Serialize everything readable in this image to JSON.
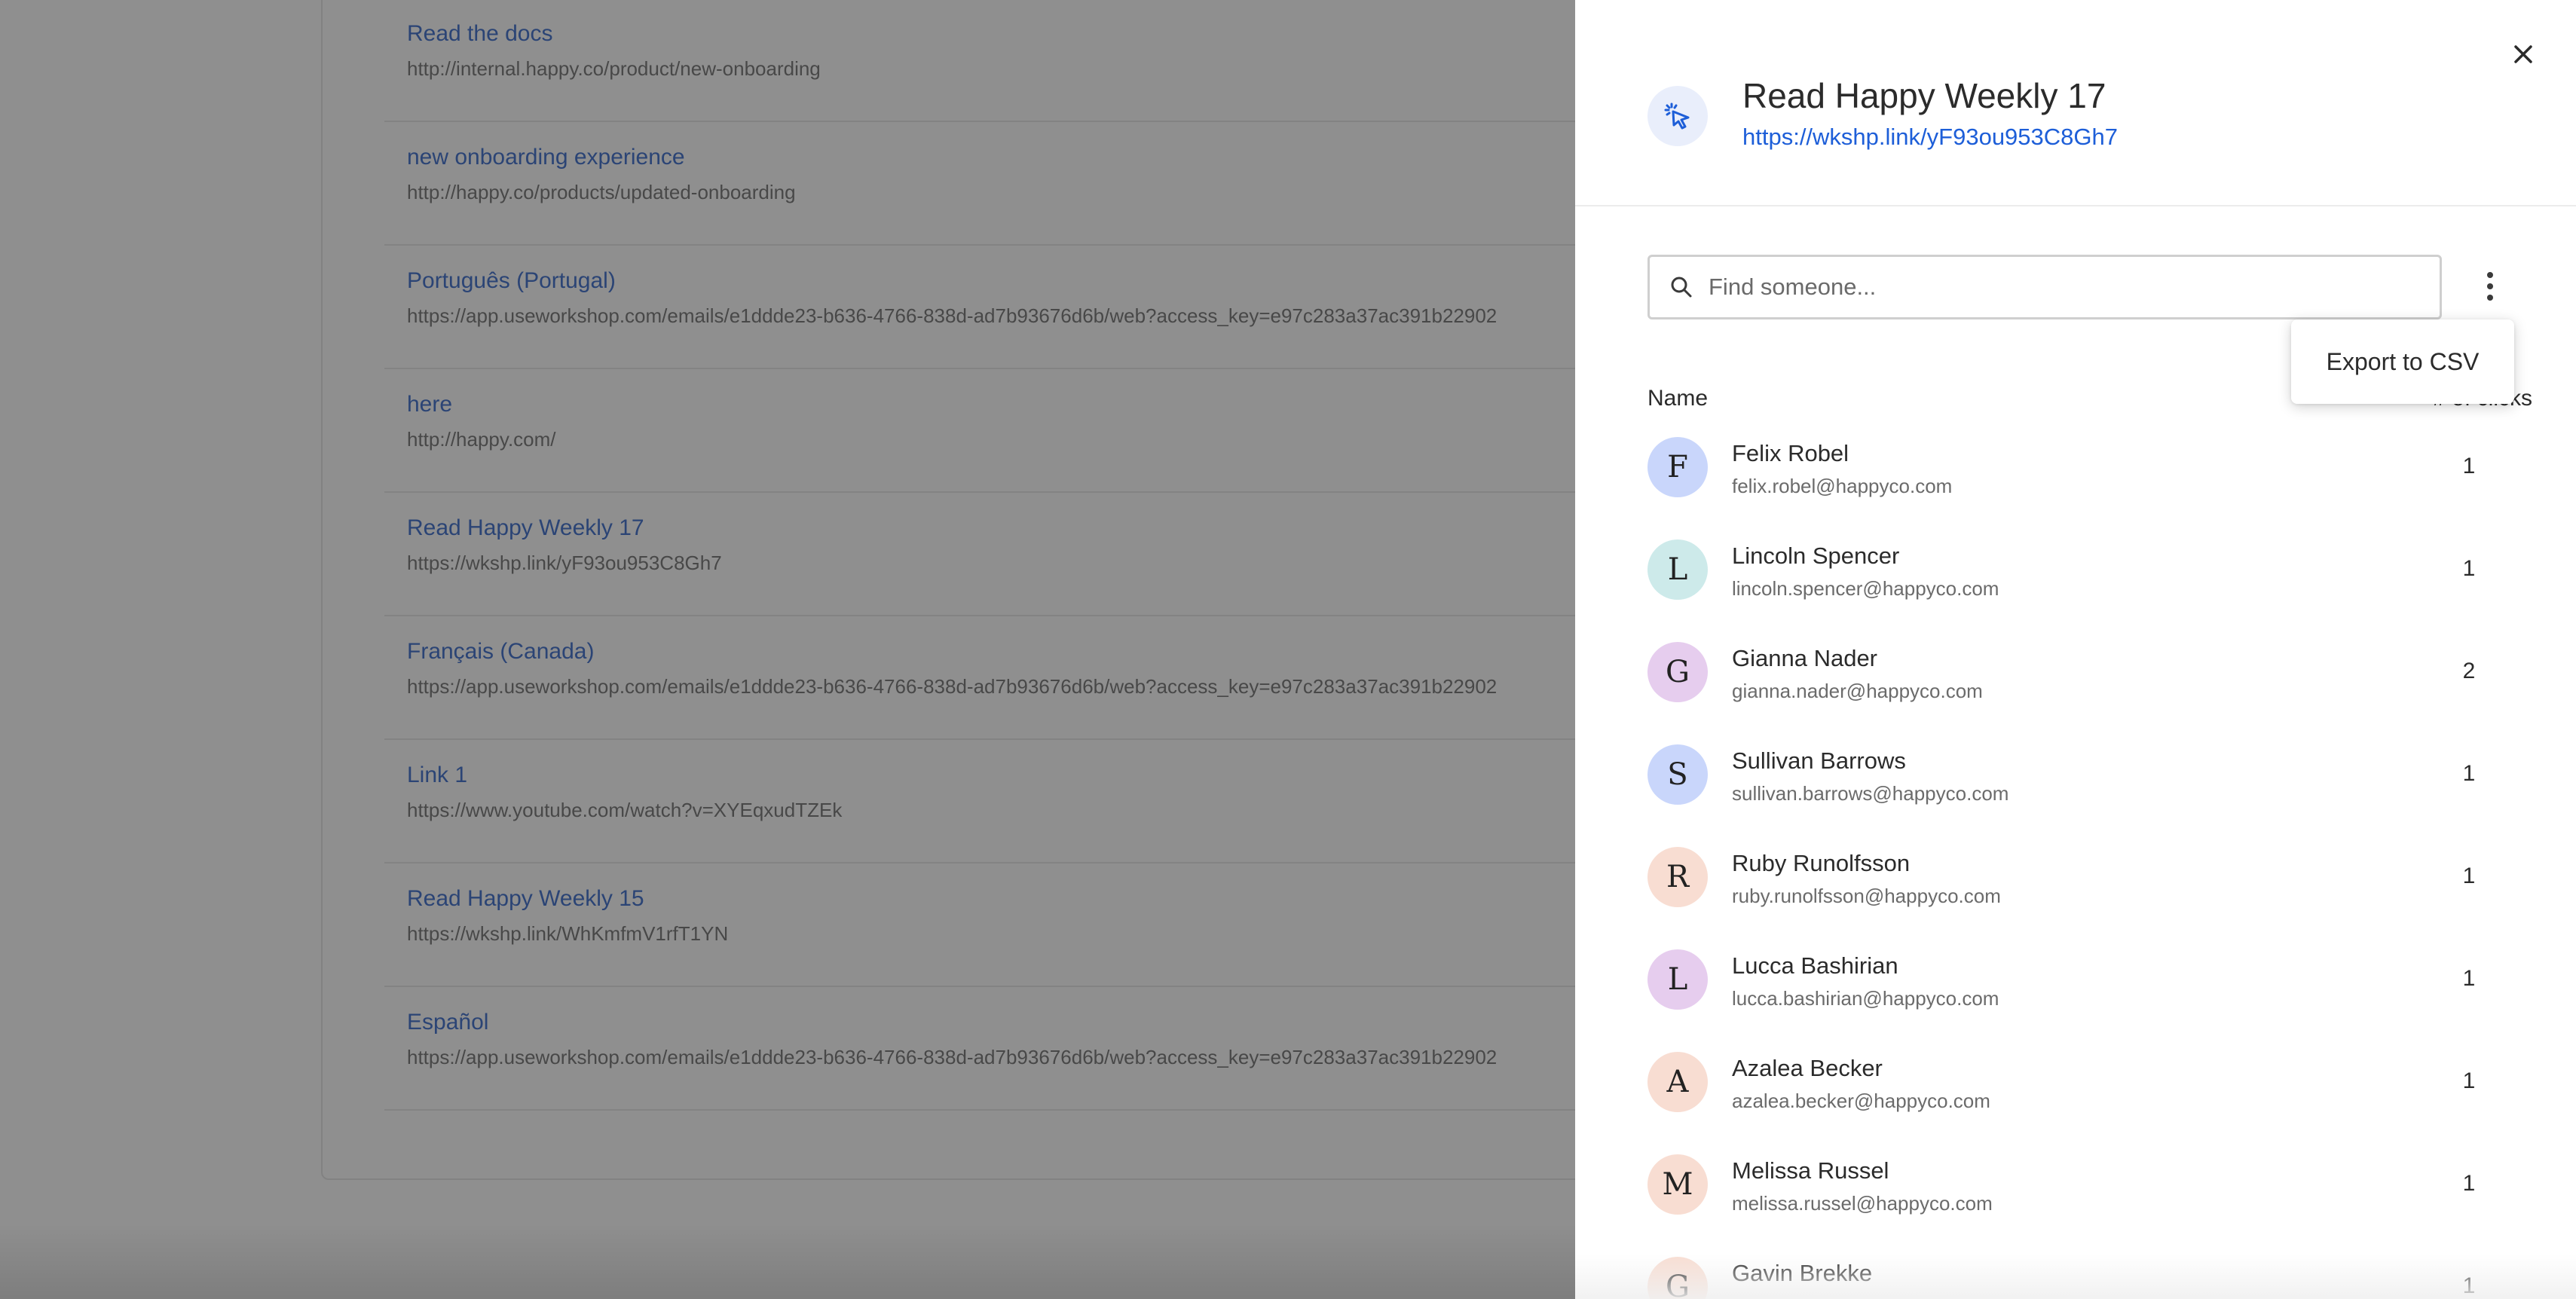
{
  "background_links": [
    {
      "title": "Read the docs",
      "url": "http://internal.happy.co/product/new-onboarding"
    },
    {
      "title": "new onboarding experience",
      "url": "http://happy.co/products/updated-onboarding"
    },
    {
      "title": "Português (Portugal)",
      "url": "https://app.useworkshop.com/emails/e1ddde23-b636-4766-838d-ad7b93676d6b/web?access_key=e97c283a37ac391b22902"
    },
    {
      "title": "here",
      "url": "http://happy.com/"
    },
    {
      "title": "Read Happy Weekly 17",
      "url": "https://wkshp.link/yF93ou953C8Gh7"
    },
    {
      "title": "Français (Canada)",
      "url": "https://app.useworkshop.com/emails/e1ddde23-b636-4766-838d-ad7b93676d6b/web?access_key=e97c283a37ac391b22902"
    },
    {
      "title": "Link 1",
      "url": "https://www.youtube.com/watch?v=XYEqxudTZEk"
    },
    {
      "title": "Read Happy Weekly 15",
      "url": "https://wkshp.link/WhKmfmV1rfT1YN"
    },
    {
      "title": "Español",
      "url": "https://app.useworkshop.com/emails/e1ddde23-b636-4766-838d-ad7b93676d6b/web?access_key=e97c283a37ac391b22902"
    }
  ],
  "drawer": {
    "title": "Read Happy Weekly 17",
    "link": "https://wkshp.link/yF93ou953C8Gh7",
    "header_icon": "cursor-click-icon",
    "close_icon": "close-icon",
    "search": {
      "placeholder": "Find someone...",
      "value": "",
      "icon": "search-icon"
    },
    "more_icon": "vertical-dots-icon",
    "columns": {
      "name": "Name",
      "clicks": "# of clicks"
    },
    "menu": {
      "export_label": "Export to CSV"
    },
    "people": [
      {
        "initial": "F",
        "name": "Felix Robel",
        "email": "felix.robel@happyco.com",
        "clicks": "1",
        "color": "#c9d6fb"
      },
      {
        "initial": "L",
        "name": "Lincoln Spencer",
        "email": "lincoln.spencer@happyco.com",
        "clicks": "1",
        "color": "#cdeaea"
      },
      {
        "initial": "G",
        "name": "Gianna Nader",
        "email": "gianna.nader@happyco.com",
        "clicks": "2",
        "color": "#e6cdee"
      },
      {
        "initial": "S",
        "name": "Sullivan Barrows",
        "email": "sullivan.barrows@happyco.com",
        "clicks": "1",
        "color": "#c9d6fb"
      },
      {
        "initial": "R",
        "name": "Ruby Runolfsson",
        "email": "ruby.runolfsson@happyco.com",
        "clicks": "1",
        "color": "#f8ddd2"
      },
      {
        "initial": "L",
        "name": "Lucca Bashirian",
        "email": "lucca.bashirian@happyco.com",
        "clicks": "1",
        "color": "#e6cdee"
      },
      {
        "initial": "A",
        "name": "Azalea Becker",
        "email": "azalea.becker@happyco.com",
        "clicks": "1",
        "color": "#f8ddd2"
      },
      {
        "initial": "M",
        "name": "Melissa Russel",
        "email": "melissa.russel@happyco.com",
        "clicks": "1",
        "color": "#f8ddd2"
      },
      {
        "initial": "G",
        "name": "Gavin Brekke",
        "email": "",
        "clicks": "1",
        "color": "#f8ddd2"
      }
    ]
  },
  "colors": {
    "link_blue": "#1d5ed8",
    "overlay": "#585858",
    "text_dark": "#2b2b2b",
    "text_muted": "#6b6b6b"
  }
}
